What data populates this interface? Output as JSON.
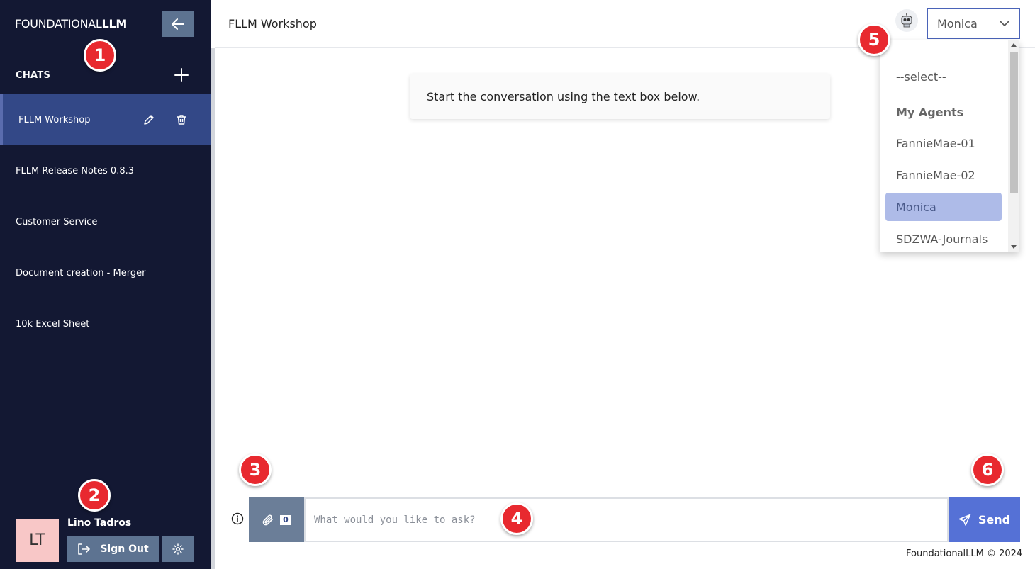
{
  "sidebar": {
    "logo_light": "FOUNDATIONAL",
    "logo_bold": "LLM",
    "chats_header": "CHATS",
    "chats": [
      {
        "label": "FLLM Workshop",
        "active": true
      },
      {
        "label": "FLLM Release Notes 0.8.3"
      },
      {
        "label": "Customer Service"
      },
      {
        "label": "Document creation - Merger"
      },
      {
        "label": "10k Excel Sheet"
      }
    ],
    "user": {
      "name": "Lino Tadros",
      "initials": "LT"
    },
    "signout_label": "Sign Out"
  },
  "header": {
    "title": "FLLM Workshop",
    "agent_selected": "Monica"
  },
  "dropdown": {
    "options": [
      {
        "label": "--select--"
      },
      {
        "label": "My Agents",
        "group": true
      },
      {
        "label": "FannieMae-01"
      },
      {
        "label": "FannieMae-02"
      },
      {
        "label": "Monica",
        "selected": true
      },
      {
        "label": "SDZWA-Journals"
      }
    ]
  },
  "conversation": {
    "start_message": "Start the conversation using the text box below."
  },
  "composer": {
    "attachment_count": "0",
    "placeholder": "What would you like to ask?",
    "send_label": "Send"
  },
  "footer": {
    "text": "FoundationalLLM © 2024"
  },
  "callouts": [
    "1",
    "2",
    "3",
    "4",
    "5",
    "6"
  ],
  "colors": {
    "sidebar_bg": "#131833",
    "active_chat_bg": "#334887",
    "button_bg": "#5d7391",
    "send_bg": "#5571d6",
    "callout_red": "#e8292f"
  }
}
